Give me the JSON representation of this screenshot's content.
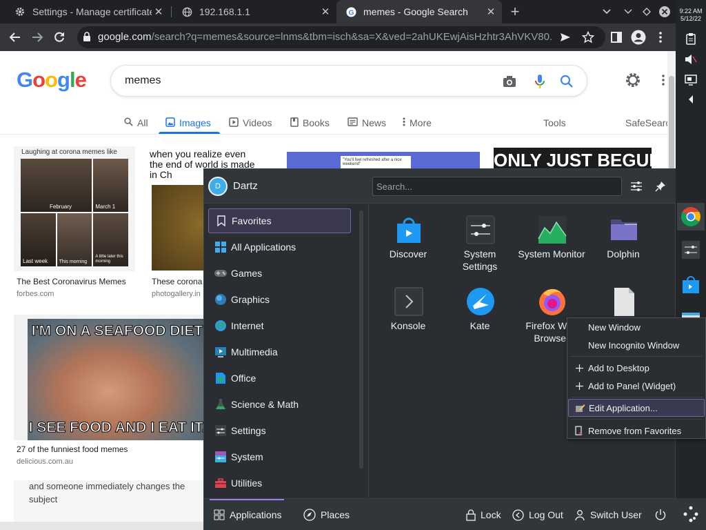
{
  "browser": {
    "tabs": [
      {
        "title": "Settings - Manage certificates",
        "favicon": "gear-icon"
      },
      {
        "title": "192.168.1.1",
        "favicon": "globe-icon"
      },
      {
        "title": "memes - Google Search",
        "favicon": "google-icon"
      }
    ],
    "close_glyph": "✕",
    "new_tab_glyph": "+",
    "url_host": "google.com",
    "url_rest": "/search?q=memes&source=lnms&tbm=isch&sa=X&ved=2ahUKEwjAisHzhtr3AhVKV80..."
  },
  "google": {
    "logo_letters": [
      "G",
      "o",
      "o",
      "g",
      "l",
      "e"
    ],
    "logo_colors": [
      "#4285f4",
      "#ea4335",
      "#fbbc05",
      "#4285f4",
      "#34a853",
      "#ea4335"
    ],
    "query": "memes",
    "tabs": [
      "All",
      "Images",
      "Videos",
      "Books",
      "News",
      "More"
    ],
    "active_tab": "Images",
    "tools": "Tools",
    "safesearch": "SafeSearch",
    "results": [
      {
        "caption": "The Best Coronavirus Memes",
        "source": "forbes.com",
        "meme_top": "Laughing at corona memes like",
        "labels": [
          "February",
          "March 1",
          "Last week",
          "This morning",
          "A little later this morning"
        ]
      },
      {
        "caption": "These corona",
        "source": "photogallery.in",
        "meme_text": "when you realize even the end of world is made in Ch"
      },
      {
        "caption": "27 of the funniest food memes",
        "source": "delicious.com.au",
        "meme_top": "I'M ON A SEAFOOD DIET",
        "meme_bottom": "I SEE FOOD AND I EAT IT."
      },
      {
        "meme_text": "and someone immediately changes the subject"
      },
      {
        "meme_text": "\"You'll feel refreshed after a nice weekend\""
      },
      {
        "meme_text": "ONLY JUST BEGUN"
      }
    ]
  },
  "system": {
    "time": "9:22 AM",
    "date": "5/12/22"
  },
  "launcher": {
    "user": "Dartz",
    "avatar_letter": "D",
    "search_placeholder": "Search...",
    "categories": [
      {
        "label": "Favorites",
        "icon": "bookmark-icon",
        "color": "#eff0f1"
      },
      {
        "label": "All Applications",
        "icon": "grid-icon",
        "color": "#3daee9"
      },
      {
        "label": "Games",
        "icon": "gamepad-icon",
        "color": "#6b6b6b"
      },
      {
        "label": "Graphics",
        "icon": "graphics-icon",
        "color": "#2980b9"
      },
      {
        "label": "Internet",
        "icon": "globe-icon",
        "color": "#27ae60"
      },
      {
        "label": "Multimedia",
        "icon": "multimedia-icon",
        "color": "#2980b9"
      },
      {
        "label": "Office",
        "icon": "office-icon",
        "color": "#1d99f3"
      },
      {
        "label": "Science & Math",
        "icon": "flask-icon",
        "color": "#4d5257"
      },
      {
        "label": "Settings",
        "icon": "settings-icon",
        "color": "#3b4045"
      },
      {
        "label": "System",
        "icon": "system-icon",
        "color": "#3daee9"
      },
      {
        "label": "Utilities",
        "icon": "toolbox-icon",
        "color": "#da4453"
      }
    ],
    "apps": [
      {
        "label": "Discover",
        "icon": "discover-icon"
      },
      {
        "label": "System Settings",
        "icon": "system-settings-icon"
      },
      {
        "label": "System Monitor",
        "icon": "system-monitor-icon"
      },
      {
        "label": "Dolphin",
        "icon": "folder-icon"
      },
      {
        "label": "Konsole",
        "icon": "terminal-icon"
      },
      {
        "label": "Kate",
        "icon": "kate-icon"
      },
      {
        "label": "Firefox Web Browser",
        "icon": "firefox-icon"
      },
      {
        "label": "",
        "icon": "document-icon"
      }
    ],
    "footer": {
      "applications": "Applications",
      "places": "Places",
      "lock": "Lock",
      "logout": "Log Out",
      "switch_user": "Switch User"
    }
  },
  "context_menu": {
    "items": [
      {
        "label": "New Window",
        "icon": ""
      },
      {
        "label": "New Incognito Window",
        "icon": ""
      },
      {
        "label": "Add to Desktop",
        "icon": "plus-icon"
      },
      {
        "label": "Add to Panel (Widget)",
        "icon": "plus-icon"
      },
      {
        "label": "Edit Application...",
        "icon": "edit-icon"
      },
      {
        "label": "Remove from Favorites",
        "icon": "remove-icon"
      }
    ],
    "highlighted": "Edit Application..."
  }
}
